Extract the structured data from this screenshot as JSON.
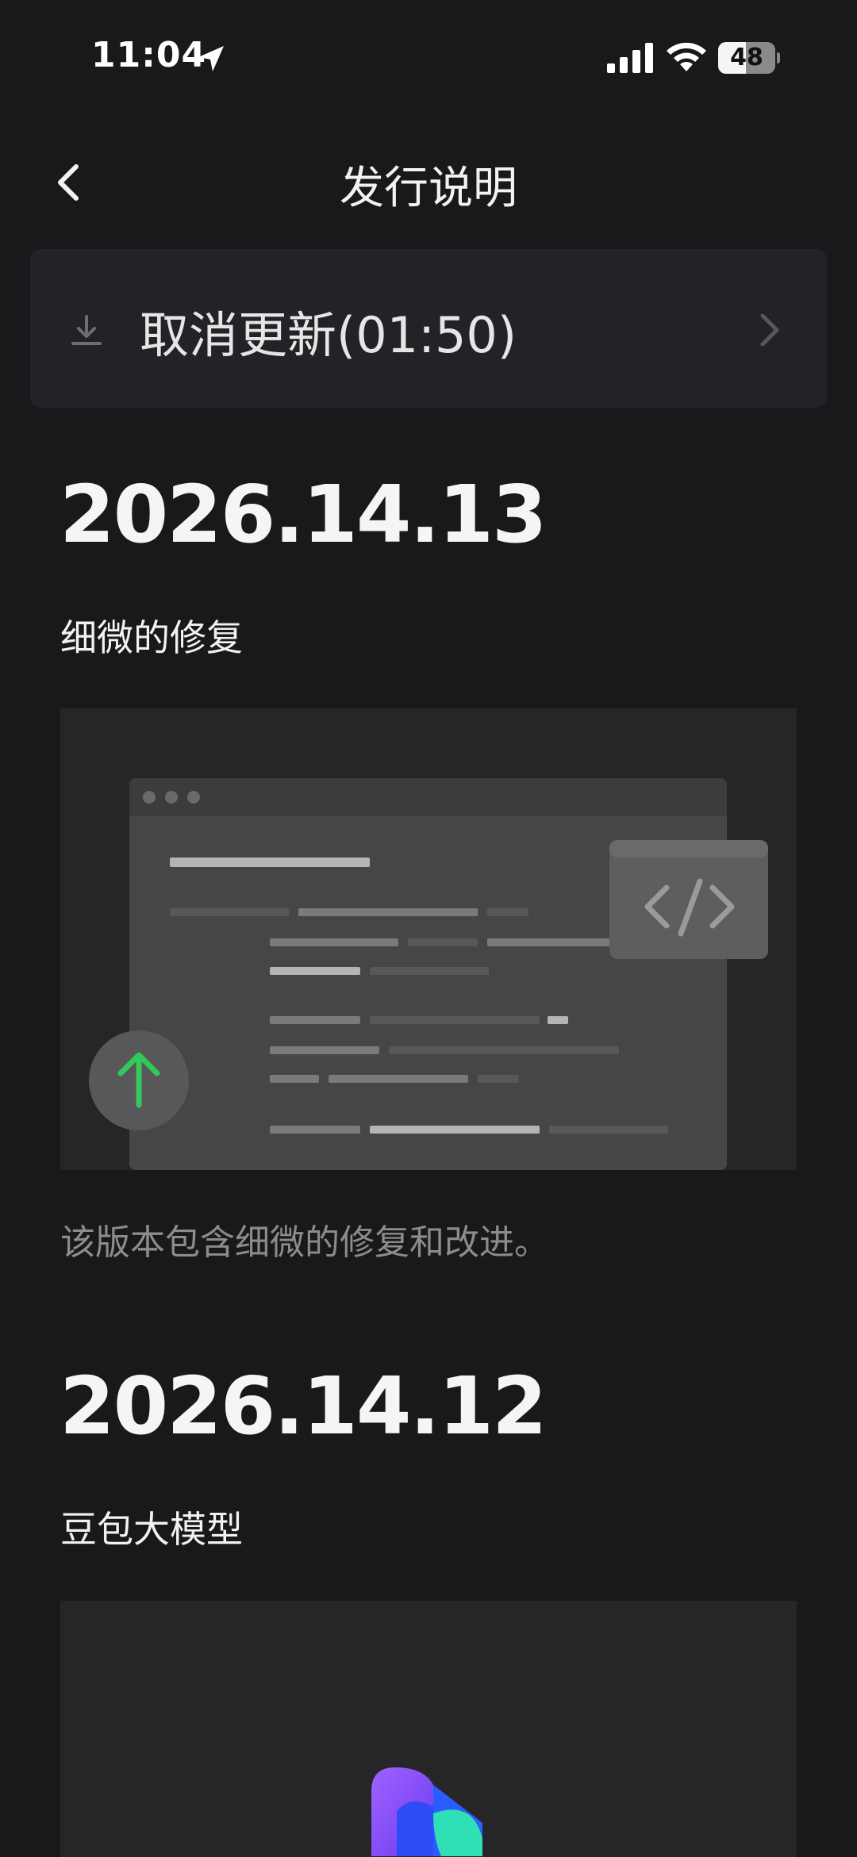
{
  "status_bar": {
    "time": "11:04",
    "battery_level": "48",
    "battery_fraction": 0.48,
    "icons": [
      "location-arrow-icon",
      "cellular-signal-icon",
      "wifi-icon",
      "battery-icon"
    ]
  },
  "nav": {
    "back_icon": "chevron-left-icon",
    "title": "发行说明"
  },
  "update_banner": {
    "icon": "download-icon",
    "label": "取消更新(01:50)",
    "chevron": "chevron-right-icon"
  },
  "releases": [
    {
      "version": "2026.14.13",
      "subtitle": "细微的修复",
      "image": "code-editor-update-illustration",
      "description": "该版本包含细微的修复和改进。"
    },
    {
      "version": "2026.14.12",
      "subtitle": "豆包大模型",
      "image": "doubao-logo-illustration"
    }
  ],
  "colors": {
    "background": "#18191b",
    "banner": "#222326",
    "accent_green": "#34c759",
    "muted_text": "#8c8c8e"
  }
}
